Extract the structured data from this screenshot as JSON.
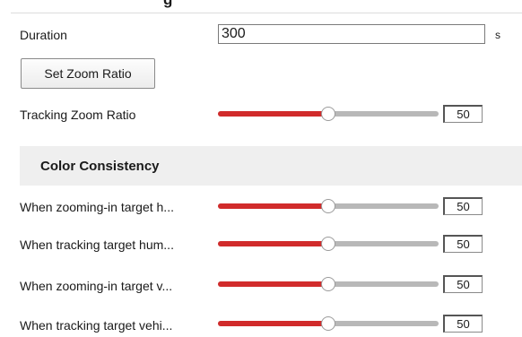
{
  "header": {
    "cut_title": "g"
  },
  "duration": {
    "label": "Duration",
    "value": "300",
    "unit": "s"
  },
  "zoom_button": {
    "label": "Set Zoom Ratio"
  },
  "tracking_zoom": {
    "label": "Tracking Zoom Ratio",
    "value": "50",
    "level": 0.5
  },
  "color_section": {
    "title": "Color Consistency"
  },
  "color_rows": [
    {
      "label": "When zooming-in target h...",
      "value": "50",
      "level": 0.5
    },
    {
      "label": "When tracking target hum...",
      "value": "50",
      "level": 0.5
    },
    {
      "label": "When zooming-in target v...",
      "value": "50",
      "level": 0.5
    },
    {
      "label": "When tracking target vehi...",
      "value": "50",
      "level": 0.5
    }
  ],
  "colors": {
    "slider_fill": "#d12b2b",
    "slider_track": "#b8b8b8",
    "section_bg": "#efefef"
  }
}
